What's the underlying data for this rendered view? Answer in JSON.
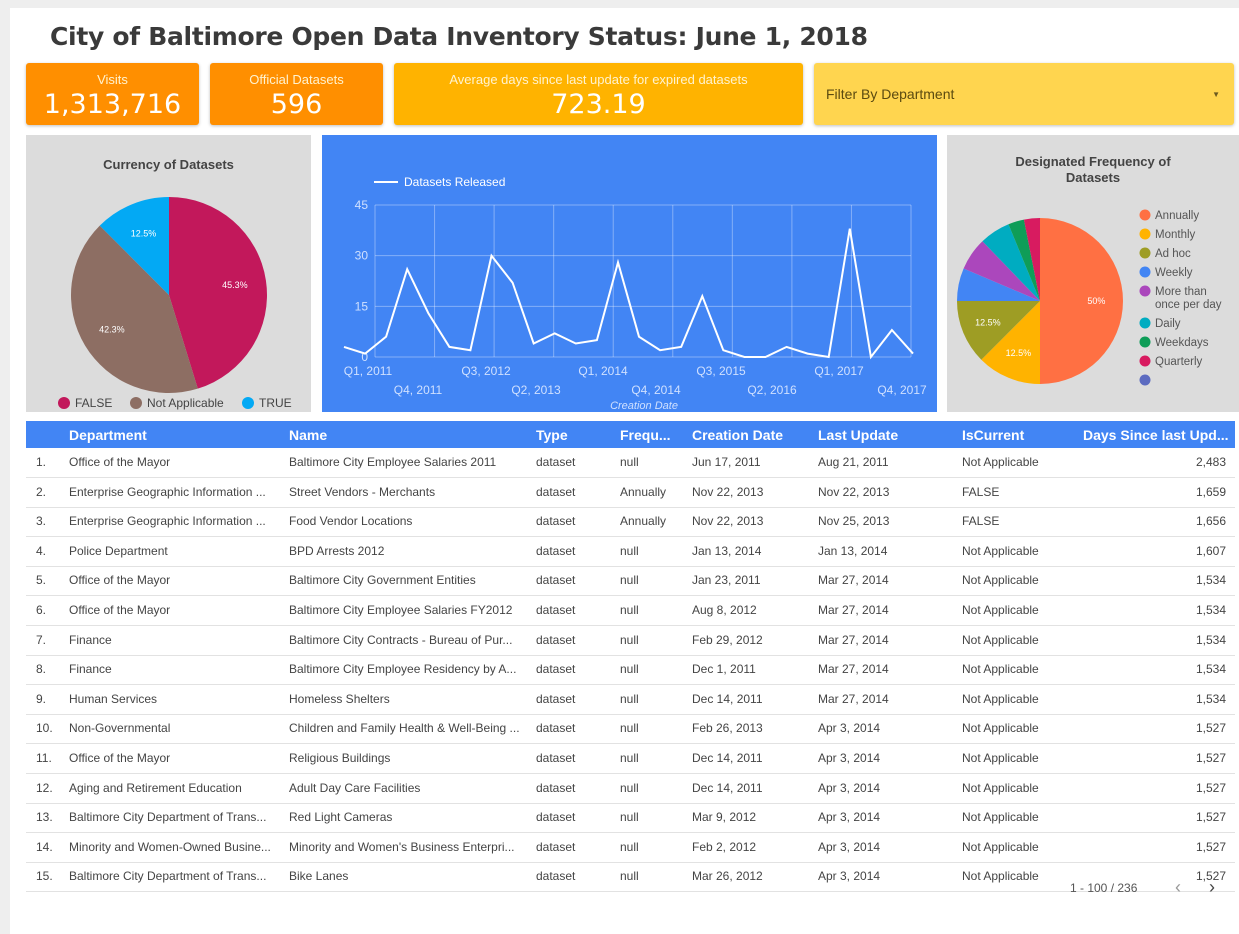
{
  "title": "City of Baltimore Open Data Inventory Status: June 1, 2018",
  "kpis": {
    "visits": {
      "label": "Visits",
      "value": "1,313,716",
      "color": "#ff8f00"
    },
    "datasets": {
      "label": "Official Datasets",
      "value": "596",
      "color": "#ff8f00"
    },
    "avg_days": {
      "label": "Average days since last update for expired datasets",
      "value": "723.19",
      "color": "#ffb300"
    }
  },
  "filter": {
    "label": "Filter By Department",
    "caret": "▼"
  },
  "currency_chart": {
    "title": "Currency of Datasets",
    "chart_data": {
      "type": "pie",
      "slices": [
        {
          "label": "FALSE",
          "value": 45.3,
          "display": "45.3%",
          "color": "#c2185b"
        },
        {
          "label": "Not Applicable",
          "value": 42.3,
          "display": "42.3%",
          "color": "#8d6e63"
        },
        {
          "label": "TRUE",
          "value": 12.5,
          "display": "12.5%",
          "color": "#03a9f4"
        }
      ],
      "legend": "bottom"
    }
  },
  "release_chart": {
    "chart_data": {
      "type": "line",
      "series": [
        {
          "name": "Datasets Released",
          "color": "#ffffff",
          "values": [
            3,
            1,
            6,
            26,
            13,
            3,
            2,
            30,
            22,
            4,
            7,
            4,
            5,
            28,
            6,
            2,
            3,
            18,
            2,
            0,
            0,
            3,
            1,
            0,
            38,
            0,
            8,
            1
          ]
        }
      ],
      "x_labels_top": [
        "Q1, 2011",
        "Q3, 2012",
        "Q1, 2014",
        "Q3, 2015",
        "Q1, 2017"
      ],
      "x_labels_bottom": [
        "Q4, 2011",
        "Q2, 2013",
        "Q4, 2014",
        "Q2, 2016",
        "Q4, 2017"
      ],
      "y_ticks": [
        "0",
        "15",
        "30",
        "45"
      ],
      "ylim": [
        0,
        45
      ],
      "xlabel": "Creation Date",
      "background": "#4285f4",
      "grid": true
    }
  },
  "frequency_chart": {
    "title_line1": "Designated Frequency of",
    "title_line2": "Datasets",
    "chart_data": {
      "type": "pie",
      "slices": [
        {
          "label": "Annually",
          "value": 50,
          "display": "50%",
          "color": "#ff7043"
        },
        {
          "label": "Monthly",
          "value": 12.5,
          "display": "12.5%",
          "color": "#ffb300"
        },
        {
          "label": "Ad hoc",
          "value": 12.5,
          "display": "12.5%",
          "color": "#9e9d24"
        },
        {
          "label": "Weekly",
          "value": 6.4,
          "display": "",
          "color": "#4285f4"
        },
        {
          "label": "More than once per day",
          "value": 6.4,
          "display": "",
          "color": "#ab47bc"
        },
        {
          "label": "Daily",
          "value": 6.0,
          "display": "",
          "color": "#00acc1"
        },
        {
          "label": "Weekdays",
          "value": 3.1,
          "display": "",
          "color": "#0f9d58"
        },
        {
          "label": "Quarterly",
          "value": 3.1,
          "display": "",
          "color": "#d81b60"
        },
        {
          "label": "",
          "value": 0,
          "display": "",
          "color": "#5c6bc0"
        }
      ],
      "legend": "right"
    }
  },
  "table": {
    "headers": [
      "Department",
      "Name",
      "Type",
      "Frequ...",
      "Creation Date",
      "Last Update",
      "IsCurrent",
      "Days Since last Upd..."
    ],
    "rows": [
      {
        "n": "1.",
        "dept": "Office of the Mayor",
        "name": "Baltimore City Employee Salaries 2011",
        "type": "dataset",
        "freq": "null",
        "created": "Jun 17, 2011",
        "updated": "Aug 21, 2011",
        "current": "Not Applicable",
        "days": "2,483"
      },
      {
        "n": "2.",
        "dept": "Enterprise Geographic Information ...",
        "name": "Street Vendors - Merchants",
        "type": "dataset",
        "freq": "Annually",
        "created": "Nov 22, 2013",
        "updated": "Nov 22, 2013",
        "current": "FALSE",
        "days": "1,659"
      },
      {
        "n": "3.",
        "dept": "Enterprise Geographic Information ...",
        "name": "Food Vendor Locations",
        "type": "dataset",
        "freq": "Annually",
        "created": "Nov 22, 2013",
        "updated": "Nov 25, 2013",
        "current": "FALSE",
        "days": "1,656"
      },
      {
        "n": "4.",
        "dept": "Police Department",
        "name": "BPD Arrests 2012",
        "type": "dataset",
        "freq": "null",
        "created": "Jan 13, 2014",
        "updated": "Jan 13, 2014",
        "current": "Not Applicable",
        "days": "1,607"
      },
      {
        "n": "5.",
        "dept": "Office of the Mayor",
        "name": "Baltimore City Government Entities",
        "type": "dataset",
        "freq": "null",
        "created": "Jan 23, 2011",
        "updated": "Mar 27, 2014",
        "current": "Not Applicable",
        "days": "1,534"
      },
      {
        "n": "6.",
        "dept": "Office of the Mayor",
        "name": "Baltimore City Employee Salaries FY2012",
        "type": "dataset",
        "freq": "null",
        "created": "Aug 8, 2012",
        "updated": "Mar 27, 2014",
        "current": "Not Applicable",
        "days": "1,534"
      },
      {
        "n": "7.",
        "dept": "Finance",
        "name": "Baltimore City Contracts - Bureau of Pur...",
        "type": "dataset",
        "freq": "null",
        "created": "Feb 29, 2012",
        "updated": "Mar 27, 2014",
        "current": "Not Applicable",
        "days": "1,534"
      },
      {
        "n": "8.",
        "dept": "Finance",
        "name": "Baltimore City Employee Residency by A...",
        "type": "dataset",
        "freq": "null",
        "created": "Dec 1, 2011",
        "updated": "Mar 27, 2014",
        "current": "Not Applicable",
        "days": "1,534"
      },
      {
        "n": "9.",
        "dept": "Human Services",
        "name": "Homeless Shelters",
        "type": "dataset",
        "freq": "null",
        "created": "Dec 14, 2011",
        "updated": "Mar 27, 2014",
        "current": "Not Applicable",
        "days": "1,534"
      },
      {
        "n": "10.",
        "dept": "Non-Governmental",
        "name": "Children and Family Health & Well-Being ...",
        "type": "dataset",
        "freq": "null",
        "created": "Feb 26, 2013",
        "updated": "Apr 3, 2014",
        "current": "Not Applicable",
        "days": "1,527"
      },
      {
        "n": "11.",
        "dept": "Office of the Mayor",
        "name": "Religious Buildings",
        "type": "dataset",
        "freq": "null",
        "created": "Dec 14, 2011",
        "updated": "Apr 3, 2014",
        "current": "Not Applicable",
        "days": "1,527"
      },
      {
        "n": "12.",
        "dept": "Aging and Retirement Education",
        "name": "Adult Day Care Facilities",
        "type": "dataset",
        "freq": "null",
        "created": "Dec 14, 2011",
        "updated": "Apr 3, 2014",
        "current": "Not Applicable",
        "days": "1,527"
      },
      {
        "n": "13.",
        "dept": "Baltimore City Department of Trans...",
        "name": "Red Light Cameras",
        "type": "dataset",
        "freq": "null",
        "created": "Mar 9, 2012",
        "updated": "Apr 3, 2014",
        "current": "Not Applicable",
        "days": "1,527"
      },
      {
        "n": "14.",
        "dept": "Minority and Women-Owned Busine...",
        "name": "Minority and Women's Business Enterpri...",
        "type": "dataset",
        "freq": "null",
        "created": "Feb 2, 2012",
        "updated": "Apr 3, 2014",
        "current": "Not Applicable",
        "days": "1,527"
      },
      {
        "n": "15.",
        "dept": "Baltimore City Department of Trans...",
        "name": "Bike Lanes",
        "type": "dataset",
        "freq": "null",
        "created": "Mar 26, 2012",
        "updated": "Apr 3, 2014",
        "current": "Not Applicable",
        "days": "1,527"
      }
    ]
  },
  "pagination": {
    "range": "1 - 100 / 236",
    "prev": "‹",
    "next": "›"
  }
}
